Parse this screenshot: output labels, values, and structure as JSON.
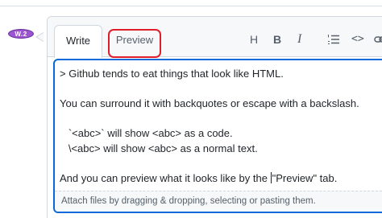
{
  "avatar": {
    "initials": "W.2"
  },
  "tabs": {
    "write": "Write",
    "preview": "Preview"
  },
  "toolbar": {
    "heading_icon_glyph": "H",
    "bold_icon_glyph": "B",
    "italic_icon_glyph": "I",
    "code_icon_glyph": "<>"
  },
  "editor": {
    "lines": [
      "> Github tends to eat things that look like HTML.",
      "",
      "You can surround it with backquotes or escape with a backslash.",
      "",
      "   `<abc>` will show <abc> as a code.",
      "   \\<abc> will show <abc> as a normal text.",
      "",
      "And you can preview what it looks like by the "
    ],
    "line_after_caret": "\"Preview\" tab.",
    "attach_hint": "Attach files by dragging & dropping, selecting or pasting them."
  },
  "colors": {
    "focus_border": "#0969da",
    "highlight_ring": "#e01e2a",
    "avatar": "#9a55cf"
  }
}
